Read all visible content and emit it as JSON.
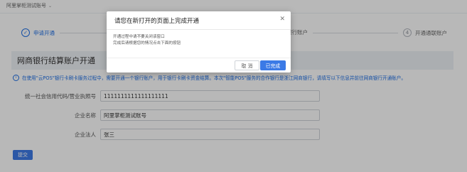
{
  "header": {
    "account_name": "阿里掌柜测试账号"
  },
  "steps": [
    {
      "label": "申请开通",
      "status": "done"
    },
    {
      "label": "网商银行账户",
      "status": "todo",
      "number": ""
    },
    {
      "label": "开通通联账户",
      "status": "todo",
      "number": "4"
    }
  ],
  "section": {
    "title": "网商银行结算账户开通"
  },
  "notice": {
    "text": "在使用\"云POS\"银行卡刷卡服务过程中，需要开通一个银行账户，用于银行卡刷卡资金结算。本次\"智能POS\"服务的合作银行是浙江网商银行，请填写以下信息并前往网商银行开通账户。"
  },
  "form": {
    "fields": [
      {
        "label": "统一社会信用代码/营业执照号",
        "value": "1111111111111111111"
      },
      {
        "label": "企业名称",
        "value": "阿里掌柜测试账号"
      },
      {
        "label": "企业法人",
        "value": "张三"
      }
    ],
    "submit_label": "提交"
  },
  "modal": {
    "title": "请您在新打开的页面上完成开通",
    "line1": "开通过程中请不要关闭该窗口",
    "line2": "完成后请根据您的情况点击下面的按钮",
    "cancel_label": "取 消",
    "done_label": "已完成"
  },
  "colors": {
    "primary": "#3b7ae6",
    "overlay": "rgba(0,0,0,0.28)"
  }
}
